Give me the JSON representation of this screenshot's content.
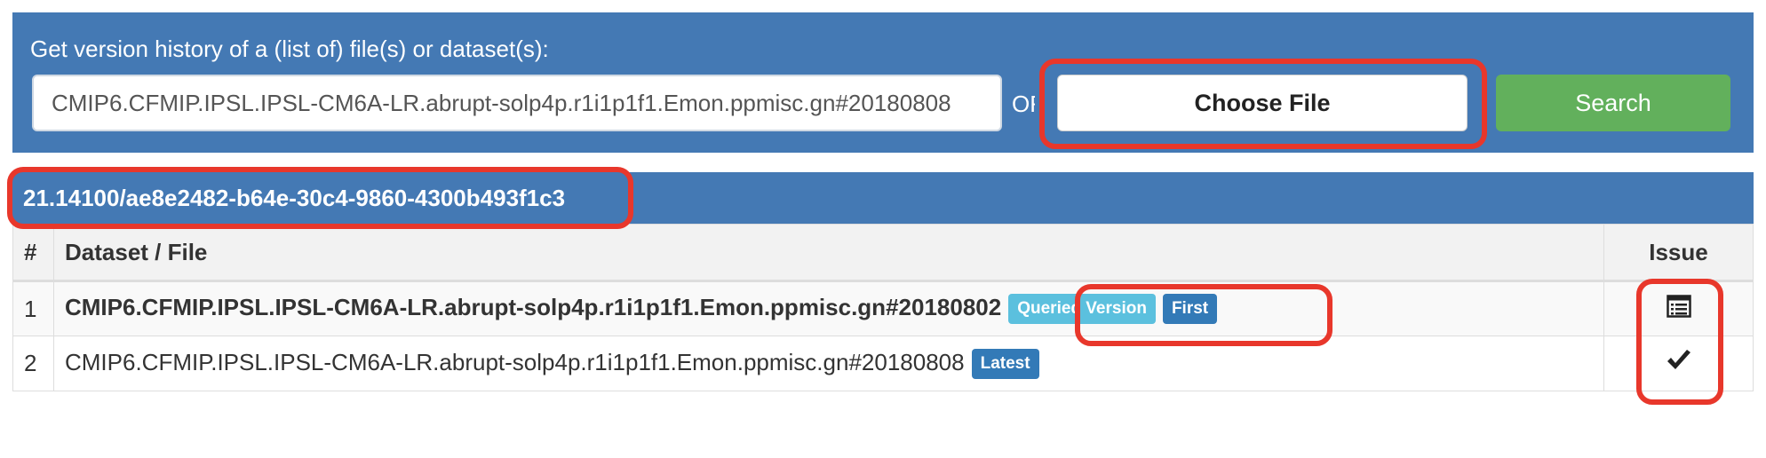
{
  "search_form": {
    "prompt": "Get version history of a (list of) file(s) or dataset(s):",
    "input_value": "CMIP6.CFMIP.IPSL.IPSL-CM6A-LR.abrupt-solp4p.r1i1p1f1.Emon.ppmisc.gn#20180808",
    "or_label": "OR",
    "choose_file_label": "Choose File",
    "search_label": "Search"
  },
  "result": {
    "pid": "21.14100/ae8e2482-b64e-30c4-9860-4300b493f1c3",
    "columns": {
      "num": "#",
      "dataset": "Dataset / File",
      "issue": "Issue"
    },
    "rows": [
      {
        "num": "1",
        "dataset": "CMIP6.CFMIP.IPSL.IPSL-CM6A-LR.abrupt-solp4p.r1i1p1f1.Emon.ppmisc.gn#20180802",
        "badges": {
          "queried": "Queried Version",
          "first": "First"
        },
        "issue_icon": "list-icon"
      },
      {
        "num": "2",
        "dataset": "CMIP6.CFMIP.IPSL.IPSL-CM6A-LR.abrupt-solp4p.r1i1p1f1.Emon.ppmisc.gn#20180808",
        "badges": {
          "latest": "Latest"
        },
        "issue_icon": "checkmark-icon"
      }
    ]
  },
  "colors": {
    "panel_blue": "#4479b4",
    "search_green": "#62b05c",
    "badge_info": "#5bc0de",
    "badge_primary": "#337ab7",
    "highlight_red": "#e8372b"
  }
}
